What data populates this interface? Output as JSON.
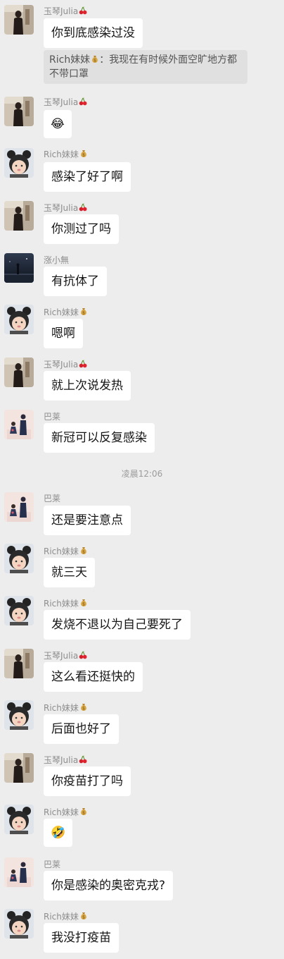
{
  "users": {
    "yuqin": "玉琴Julia",
    "rich": "Rich妹妹",
    "zhang": "涨小無",
    "bacai": "巴莱"
  },
  "icons": {
    "cherry": "cherry-icon",
    "moneybag": "money-bag-icon"
  },
  "colors": {
    "background": "#ededed",
    "bubble": "#ffffff",
    "quote": "#e0e0e0",
    "name": "#8d8d8d"
  },
  "quote": {
    "author": "Rich妹妹",
    "text": "我现在有时候外面空旷地方都不带口罩",
    "separator": "："
  },
  "timestamp": "凌晨12:06",
  "messages": [
    {
      "sender": "玉琴Julia",
      "text": "你到底感染过没"
    },
    {
      "sender": "玉琴Julia",
      "text": "😂"
    },
    {
      "sender": "Rich妹妹",
      "text": "感染了好了啊"
    },
    {
      "sender": "玉琴Julia",
      "text": "你测过了吗"
    },
    {
      "sender": "涨小無",
      "text": "有抗体了"
    },
    {
      "sender": "Rich妹妹",
      "text": "嗯啊"
    },
    {
      "sender": "玉琴Julia",
      "text": "就上次说发热"
    },
    {
      "sender": "巴莱",
      "text": "新冠可以反复感染"
    },
    {
      "sender": "巴莱",
      "text": "还是要注意点"
    },
    {
      "sender": "Rich妹妹",
      "text": "就三天"
    },
    {
      "sender": "Rich妹妹",
      "text": "发烧不退以为自己要死了"
    },
    {
      "sender": "玉琴Julia",
      "text": "这么看还挺快的"
    },
    {
      "sender": "Rich妹妹",
      "text": "后面也好了"
    },
    {
      "sender": "玉琴Julia",
      "text": "你疫苗打了吗"
    },
    {
      "sender": "Rich妹妹",
      "text": "🤣"
    },
    {
      "sender": "巴莱",
      "text": "你是感染的奥密克戎?"
    },
    {
      "sender": "Rich妹妹",
      "text": "我没打疫苗"
    }
  ]
}
